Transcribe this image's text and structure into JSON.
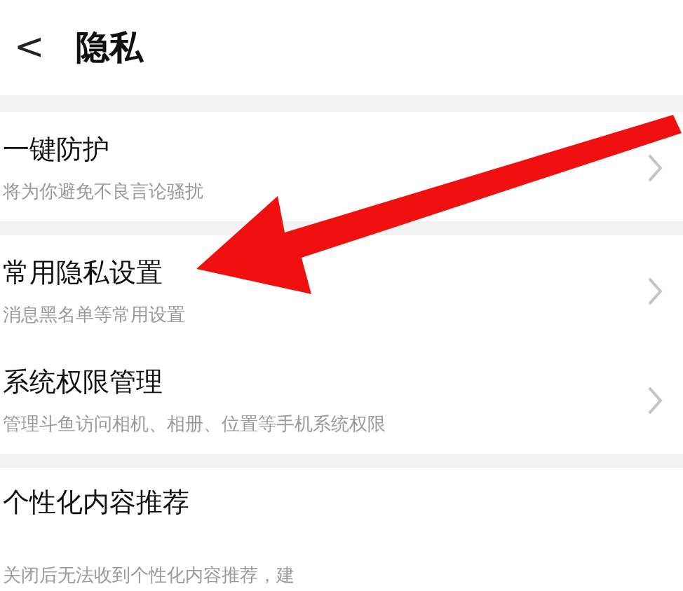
{
  "header": {
    "back_icon": "<",
    "title": "隐私"
  },
  "sections": [
    {
      "items": [
        {
          "title": "一键防护",
          "subtitle": "将为你避免不良言论骚扰",
          "chevron": true
        }
      ]
    },
    {
      "items": [
        {
          "title": "常用隐私设置",
          "subtitle": "消息黑名单等常用设置",
          "chevron": true
        },
        {
          "title": "系统权限管理",
          "subtitle": "管理斗鱼访问相机、相册、位置等手机系统权限",
          "chevron": true
        }
      ]
    },
    {
      "items": [
        {
          "title": "个性化内容推荐",
          "subtitle": "关闭后无法收到个性化内容推荐，建",
          "chevron": false
        }
      ]
    }
  ]
}
